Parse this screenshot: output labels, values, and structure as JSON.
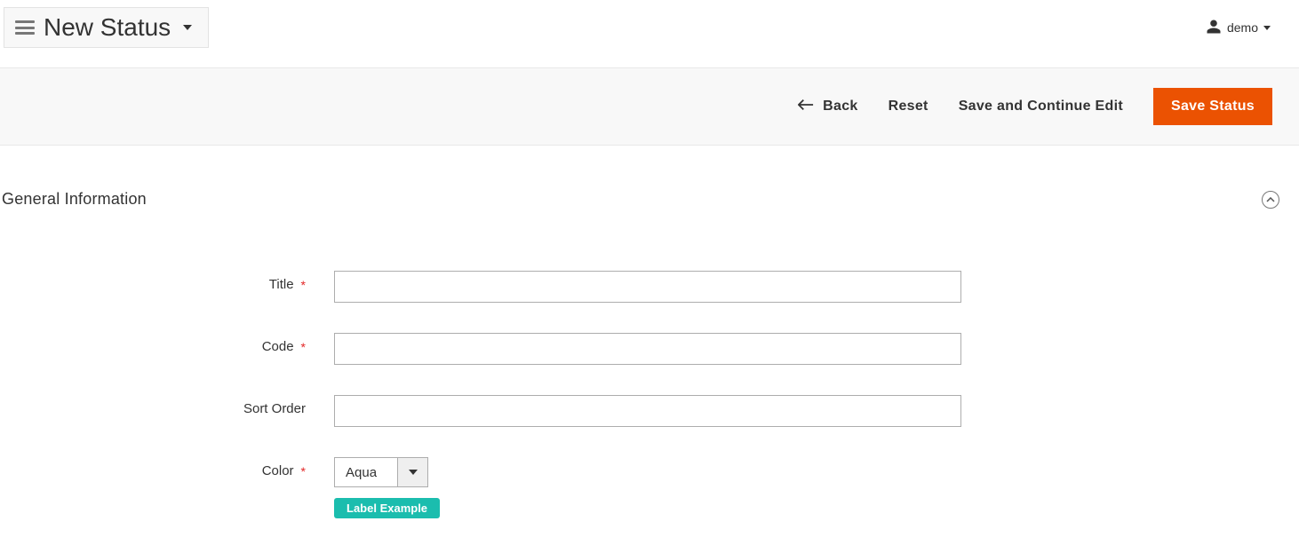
{
  "header": {
    "page_title": "New Status",
    "user_name": "demo"
  },
  "actions": {
    "back": "Back",
    "reset": "Reset",
    "save_continue": "Save and Continue Edit",
    "save": "Save Status"
  },
  "section": {
    "title": "General Information"
  },
  "form": {
    "fields": {
      "title": {
        "label": "Title",
        "required": true,
        "value": ""
      },
      "code": {
        "label": "Code",
        "required": true,
        "value": ""
      },
      "sort_order": {
        "label": "Sort Order",
        "required": false,
        "value": ""
      },
      "color": {
        "label": "Color",
        "required": true,
        "value": "Aqua",
        "example_label": "Label Example",
        "example_color": "#1bbdae"
      }
    }
  }
}
